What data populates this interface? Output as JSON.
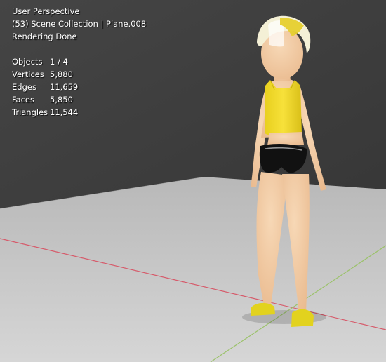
{
  "viewport": {
    "view_name": "User Perspective",
    "collection_path": "(53) Scene Collection | Plane.008",
    "render_status": "Rendering Done"
  },
  "stats": [
    {
      "label": "Objects",
      "value": "1 / 4"
    },
    {
      "label": "Vertices",
      "value": "5,880"
    },
    {
      "label": "Edges",
      "value": "11,659"
    },
    {
      "label": "Faces",
      "value": "5,850"
    },
    {
      "label": "Triangles",
      "value": "11,544"
    }
  ],
  "colors": {
    "wall": "#3e3e3e",
    "floor": "#c9c9c9",
    "x_axis": "#d65a6a",
    "y_axis": "#9bc26a",
    "top": "#f2dc2a",
    "shorts": "#111111",
    "skin": "#f2c9a2",
    "hair": "#f4f0d6",
    "shoes": "#e2d21e"
  }
}
